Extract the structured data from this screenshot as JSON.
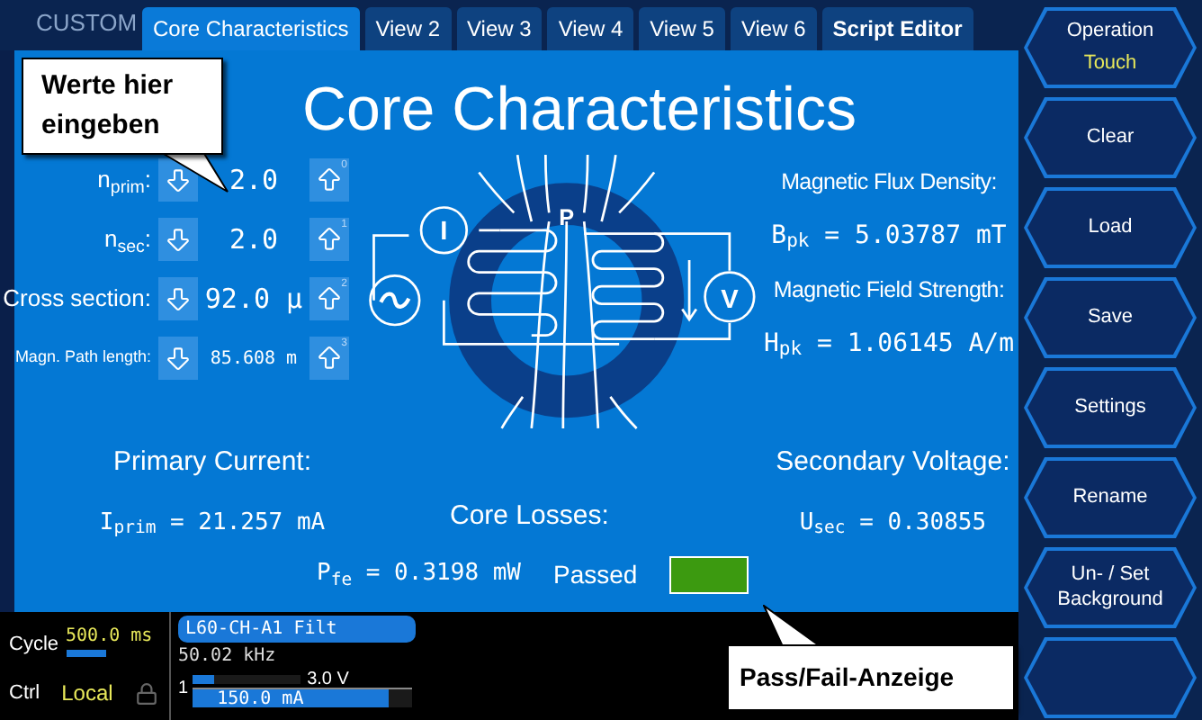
{
  "brand": "CUSTOM",
  "tabs": [
    {
      "label": "Core Characteristics",
      "selected": true
    },
    {
      "label": "View 2",
      "selected": false
    },
    {
      "label": "View 3",
      "selected": false
    },
    {
      "label": "View 4",
      "selected": false
    },
    {
      "label": "View 5",
      "selected": false
    },
    {
      "label": "View 6",
      "selected": false
    },
    {
      "label": "Script Editor",
      "selected": false
    }
  ],
  "title": "Core Characteristics",
  "inputs": [
    {
      "label": "n$_{prim}$:",
      "value": "2.0",
      "step": "0",
      "kind": "normal"
    },
    {
      "label": "n$_{sec}$:",
      "value": "2.0",
      "step": "1",
      "kind": "normal"
    },
    {
      "label": "Cross section:",
      "value": "92.0 µ",
      "step": "2",
      "kind": "normal"
    },
    {
      "label": "Magn. Path length:",
      "value": "85.608 m",
      "step": "3",
      "kind": "small"
    }
  ],
  "diagram": {
    "core_label": "P",
    "current_symbol": "I",
    "voltage_symbol": "V"
  },
  "readings": [
    {
      "label": "Magnetic Flux Density:",
      "value": "B$_{pk}$ = 5.03787 mT"
    },
    {
      "label": "Magnetic Field Strength:",
      "value": "H$_{pk}$ = 1.06145 A/m"
    }
  ],
  "primary_current": {
    "label": "Primary Current:",
    "value": "I$_{prim}$ = 21.257 mA"
  },
  "secondary_voltage": {
    "label": "Secondary Voltage:",
    "value": "U$_{sec}$ = 0.30855"
  },
  "core_losses": {
    "label": "Core Losses:",
    "value": "P$_{fe}$ = 0.3198 mW",
    "status": "Passed",
    "passed": true
  },
  "bottom": {
    "cycle_label": "Cycle",
    "cycle_value": "500.0 ms",
    "ctrl_label": "Ctrl",
    "ctrl_value": "Local",
    "channel": "L60-CH-A1 Filt",
    "frequency": "50.02 kHz",
    "channel_number": "1",
    "voltage": {
      "text": "3.0 V",
      "level": 0.2
    },
    "current": {
      "text": "150.0 mA",
      "level": 0.9
    }
  },
  "side_buttons": [
    {
      "kind": "labeled",
      "label": "Operation",
      "value": "Touch"
    },
    {
      "kind": "labeled",
      "label": "Clear"
    },
    {
      "kind": "labeled",
      "label": "Load"
    },
    {
      "kind": "labeled",
      "label": "Save"
    },
    {
      "kind": "labeled",
      "label": "Settings"
    },
    {
      "kind": "labeled",
      "label": "Rename"
    },
    {
      "kind": "labeled",
      "label": "Un- / Set Background"
    },
    {
      "kind": "empty"
    }
  ],
  "callouts": [
    {
      "text": "Werte hier eingeben",
      "kind": "inputs"
    },
    {
      "text": "Pass/Fail-Anzeige",
      "kind": "status"
    }
  ]
}
